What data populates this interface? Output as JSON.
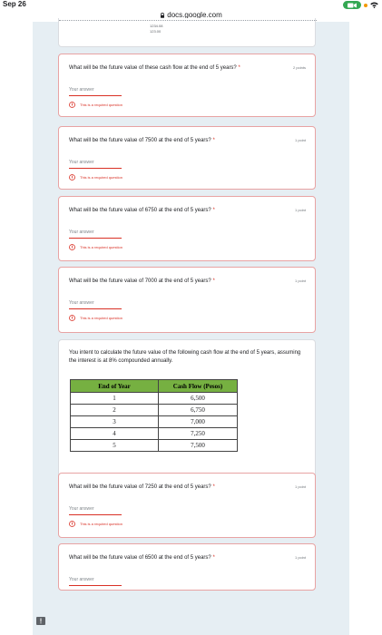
{
  "status_bar": {
    "date": "Sep 26"
  },
  "browser": {
    "url": "docs.google.com"
  },
  "cutoff_card": {
    "values": [
      "1234.08",
      "123.00"
    ]
  },
  "questions": [
    {
      "text": "What will be the future value of these cash flow at the end of 5 years?",
      "required_mark": "*",
      "points": "2 points",
      "answer_placeholder": "Your answer",
      "error": "This is a required question"
    },
    {
      "text": "What will be the future value of 7500 at the end of 5 years?",
      "required_mark": "*",
      "points": "1 point",
      "answer_placeholder": "Your answer",
      "error": "This is a required question"
    },
    {
      "text": "What will be the future value of 6750 at the end of 5 years?",
      "required_mark": "*",
      "points": "1 point",
      "answer_placeholder": "Your answer",
      "error": "This is a required question"
    },
    {
      "text": "What will be the future value of 7000 at the end of 5 years?",
      "required_mark": "*",
      "points": "1 point",
      "answer_placeholder": "Your answer",
      "error": "This is a required question"
    },
    {
      "text": "What will be the future value of 7250 at the end of 5 years?",
      "required_mark": "*",
      "points": "1 point",
      "answer_placeholder": "Your answer",
      "error": "This is a required question"
    },
    {
      "text": "What will be the future value of 6500 at the end of 5 years?",
      "required_mark": "*",
      "points": "1 point",
      "answer_placeholder": "Your answer"
    }
  ],
  "info_card": {
    "text": "You intent to calculate the future value of the following cash flow at the end of 5 years, assuming the interest is at 8% compounded annually.",
    "table": {
      "headers": [
        "End of Year",
        "Cash Flow (Pesos)"
      ],
      "rows": [
        [
          "1",
          "6,500"
        ],
        [
          "2",
          "6,750"
        ],
        [
          "3",
          "7,000"
        ],
        [
          "4",
          "7,250"
        ],
        [
          "5",
          "7,500"
        ]
      ]
    }
  },
  "colors": {
    "error_red": "#d93025",
    "table_header_green": "#76b041",
    "page_background": "#e6eef3"
  }
}
